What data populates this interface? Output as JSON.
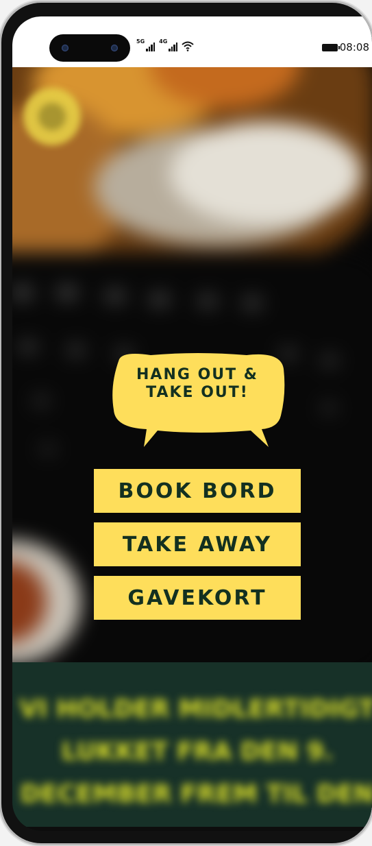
{
  "status_bar": {
    "network1": "5G",
    "network2": "4G",
    "wifi_icon": "wifi-icon",
    "battery_icon": "battery-icon",
    "time": "08:08"
  },
  "hero": {
    "logo_icon": "restaurant-logo-icon",
    "bubble_line1": "HANG OUT &",
    "bubble_line2": "TAKE OUT!"
  },
  "buttons": {
    "book": "BOOK BORD",
    "takeaway": "TAKE AWAY",
    "giftcard": "GAVEKORT"
  },
  "announcement": {
    "line1": "VI HOLDER MIDLERTIDIGT",
    "line2": "LUKKET FRA DEN 9.",
    "line3": "DECEMBER FREM TIL DEN"
  },
  "colors": {
    "accent_yellow": "#fede5b",
    "dark_green": "#133020",
    "teal_bg": "#173128"
  }
}
